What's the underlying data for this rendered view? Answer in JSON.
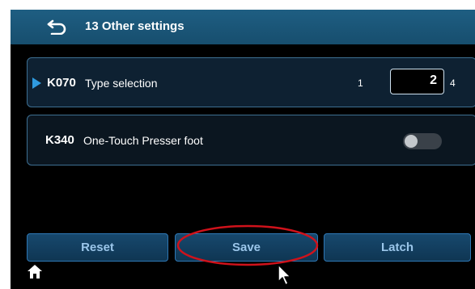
{
  "header": {
    "title": "13 Other settings",
    "icon": "back-arrow-icon"
  },
  "settings": [
    {
      "code": "K070",
      "label": "Type selection",
      "range_min": "1",
      "value": "2",
      "range_max": "4",
      "selected": true
    },
    {
      "code": "K340",
      "label": "One-Touch Presser foot",
      "toggle_on": false
    }
  ],
  "buttons": {
    "reset": "Reset",
    "save": "Save",
    "latch": "Latch"
  },
  "footer": {
    "icon": "home-icon"
  },
  "colors": {
    "header": "#1e5e82",
    "accent": "#2f9be0",
    "annotation": "#d0121b",
    "button_text": "#9bc6ea"
  }
}
